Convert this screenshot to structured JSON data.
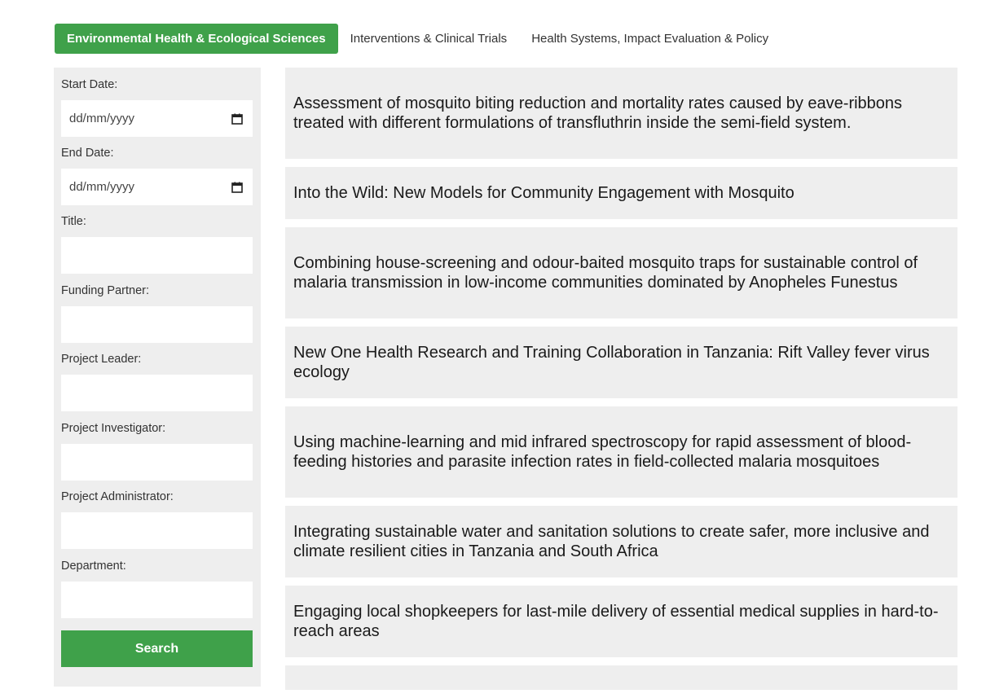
{
  "tabs": [
    {
      "label": "Environmental Health & Ecological Sciences",
      "active": true
    },
    {
      "label": "Interventions & Clinical Trials",
      "active": false
    },
    {
      "label": "Health Systems, Impact Evaluation & Policy",
      "active": false
    }
  ],
  "filters": {
    "start_date": {
      "label": "Start Date:",
      "placeholder": "dd/mm/yyyy"
    },
    "end_date": {
      "label": "End Date:",
      "placeholder": "dd/mm/yyyy"
    },
    "title": {
      "label": "Title:",
      "value": ""
    },
    "funding_partner": {
      "label": "Funding Partner:",
      "value": ""
    },
    "project_leader": {
      "label": "Project Leader:",
      "value": ""
    },
    "project_investigator": {
      "label": "Project Investigator:",
      "value": ""
    },
    "project_administrator": {
      "label": "Project Administrator:",
      "value": ""
    },
    "department": {
      "label": "Department:",
      "value": ""
    },
    "search_label": "Search"
  },
  "results": [
    "Assessment of mosquito biting reduction and mortality rates caused by eave-ribbons treated with different formulations of transfluthrin inside the semi-field system.",
    "Into the Wild: New Models for Community Engagement with Mosquito",
    "Combining house-screening and odour-baited mosquito traps for sustainable control of malaria transmission in low-income communities dominated by Anopheles Funestus",
    "New One Health Research and Training Collaboration in Tanzania: Rift Valley fever virus ecology",
    "Using machine-learning and mid infrared spectroscopy for rapid assessment of blood-feeding histories and parasite infection rates in field-collected malaria mosquitoes",
    "Integrating sustainable water and sanitation solutions to create safer, more inclusive and climate resilient cities in Tanzania and South Africa",
    "Engaging local shopkeepers for last-mile delivery of essential medical supplies in hard-to-reach areas"
  ],
  "colors": {
    "accent": "#3fa14a",
    "panel": "#eeeeee"
  },
  "icons": {
    "date": "calendar-icon"
  }
}
